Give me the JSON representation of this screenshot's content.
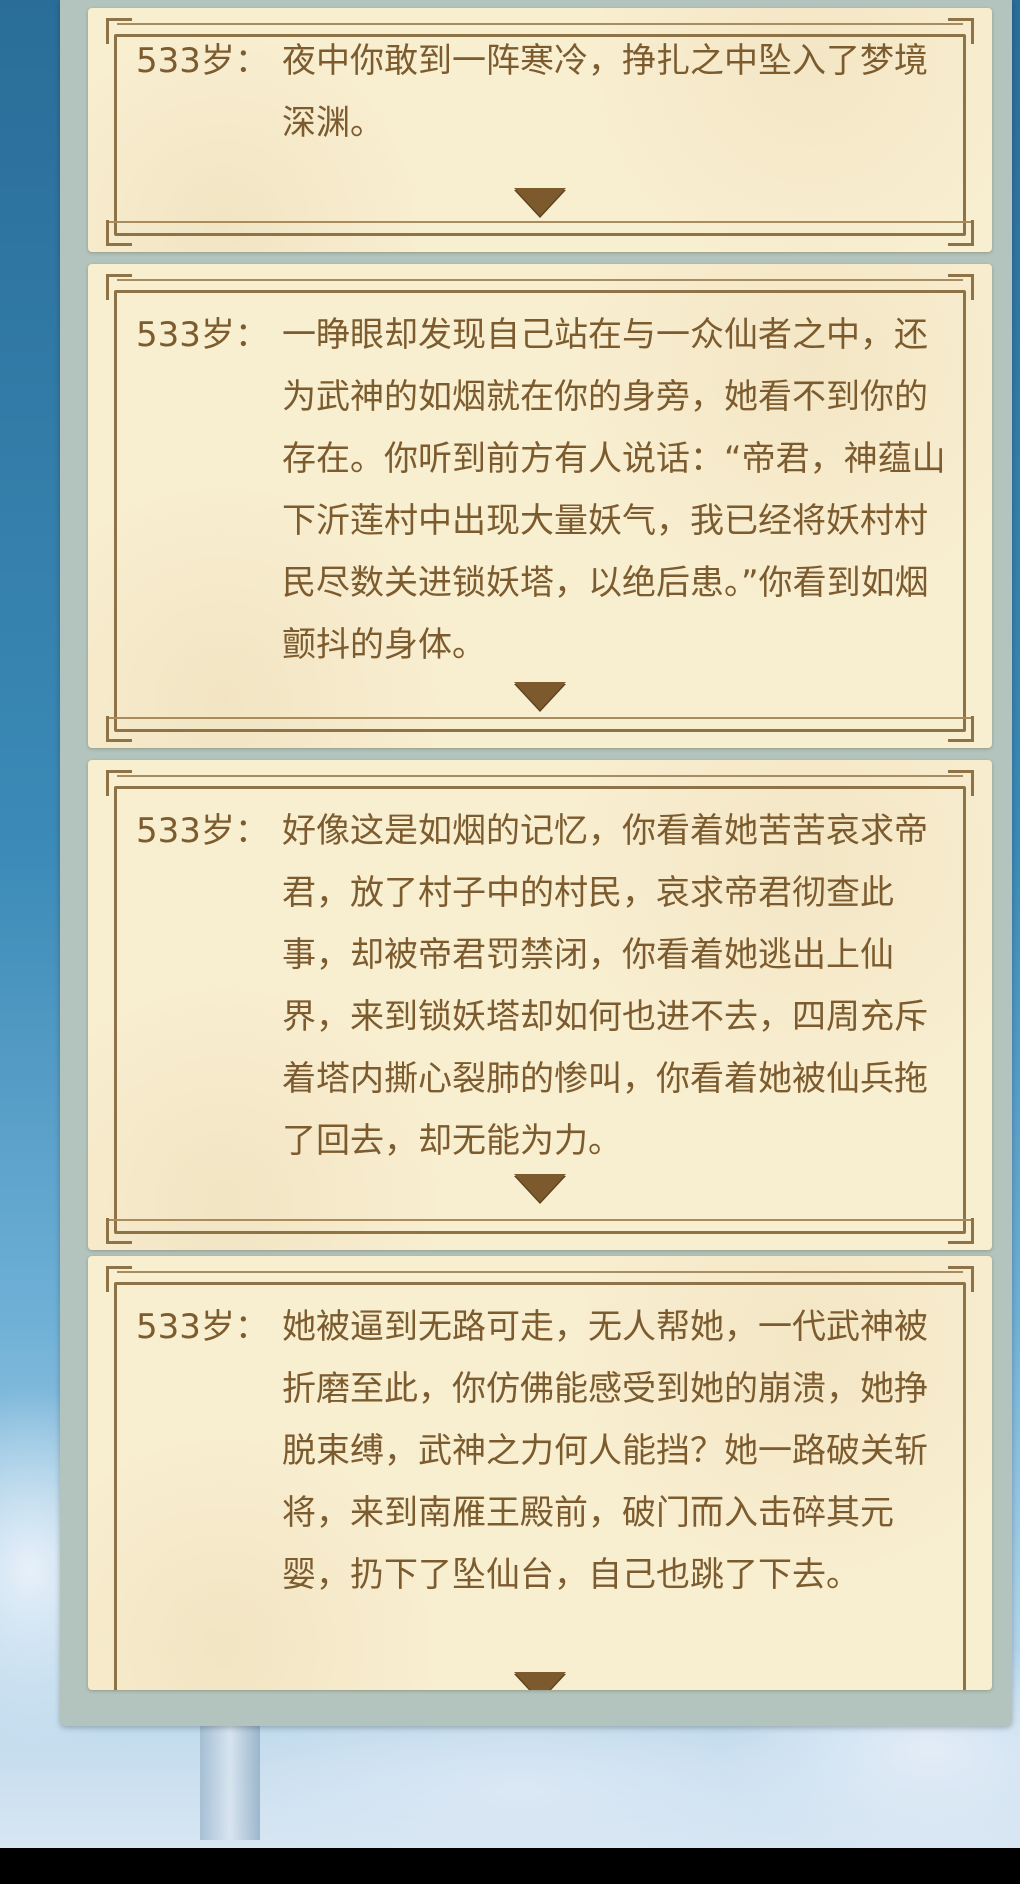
{
  "events": [
    {
      "age": "533岁：",
      "text": "夜中你敢到一阵寒冷，挣扎之中坠入了梦境深渊。"
    },
    {
      "age": "533岁：",
      "text": "一睁眼却发现自己站在与一众仙者之中，还为武神的如烟就在你的身旁，她看不到你的存在。你听到前方有人说话：“帝君，神蕴山下沂莲村中出现大量妖气，我已经将妖村村民尽数关进锁妖塔，以绝后患。”你看到如烟颤抖的身体。"
    },
    {
      "age": "533岁：",
      "text": "好像这是如烟的记忆，你看着她苦苦哀求帝君，放了村子中的村民，哀求帝君彻查此事，却被帝君罚禁闭，你看着她逃出上仙界，来到锁妖塔却如何也进不去，四周充斥着塔内撕心裂肺的惨叫，你看着她被仙兵拖了回去，却无能为力。"
    },
    {
      "age": "533岁：",
      "text": "她被逼到无路可走，无人帮她，一代武神被折磨至此，你仿佛能感受到她的崩溃，她挣脱束缚，武神之力何人能挡？她一路破关斩将，来到南雁王殿前，破门而入击碎其元婴，扔下了坠仙台，自己也跳了下去。"
    }
  ],
  "expand_icon": "triangle-down-icon"
}
